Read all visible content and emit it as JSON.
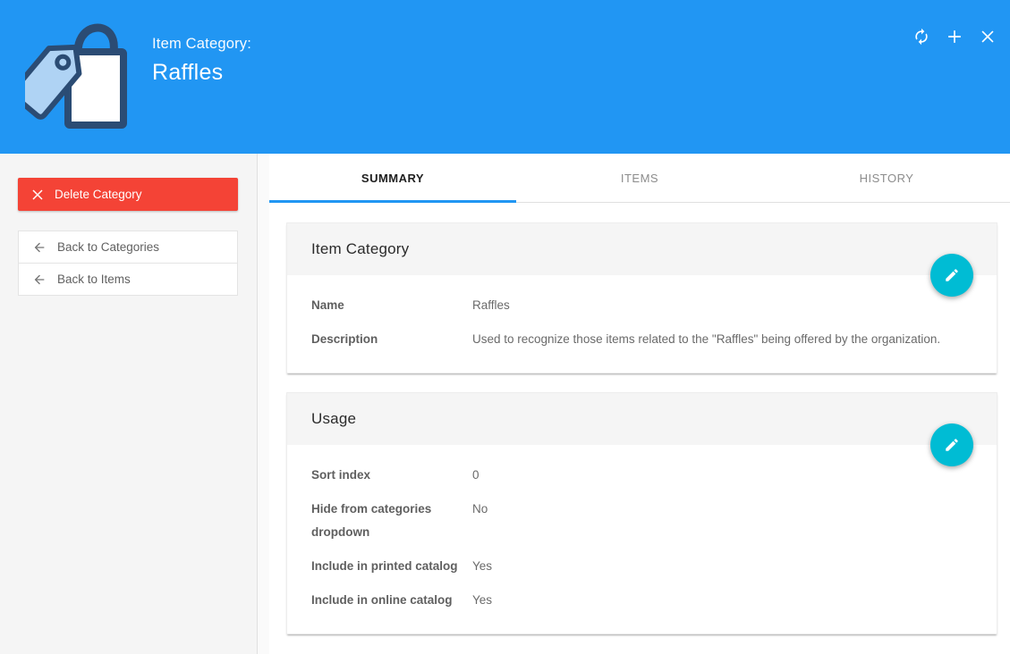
{
  "colors": {
    "header_bg": "#2196F3",
    "accent_blue": "#2196F3",
    "delete_red": "#F44336",
    "fab_teal": "#00BCD4",
    "icon_navy": "#2B4C74",
    "tag_light_blue": "#AFD3F4"
  },
  "header": {
    "label": "Item Category:",
    "title": "Raffles",
    "icon": "shopping-bag-with-tag",
    "actions": [
      {
        "name": "refresh"
      },
      {
        "name": "add"
      },
      {
        "name": "close"
      }
    ]
  },
  "sidebar": {
    "delete_button": "Delete Category",
    "links": [
      "Back to Categories",
      "Back to Items"
    ]
  },
  "tabs": [
    {
      "label": "SUMMARY",
      "active": true
    },
    {
      "label": "ITEMS",
      "active": false
    },
    {
      "label": "HISTORY",
      "active": false
    }
  ],
  "cards": [
    {
      "title": "Item Category",
      "edit_action": "edit",
      "rows": [
        {
          "label": "Name",
          "value": "Raffles"
        },
        {
          "label": "Description",
          "value": "Used to recognize those items related to the \"Raffles\" being offered by the organization."
        }
      ]
    },
    {
      "title": "Usage",
      "edit_action": "edit",
      "rows": [
        {
          "label": "Sort index",
          "value": "0"
        },
        {
          "label": "Hide from categories dropdown",
          "value": "No"
        },
        {
          "label": "Include in printed catalog",
          "value": "Yes"
        },
        {
          "label": "Include in online catalog",
          "value": "Yes"
        }
      ]
    }
  ]
}
